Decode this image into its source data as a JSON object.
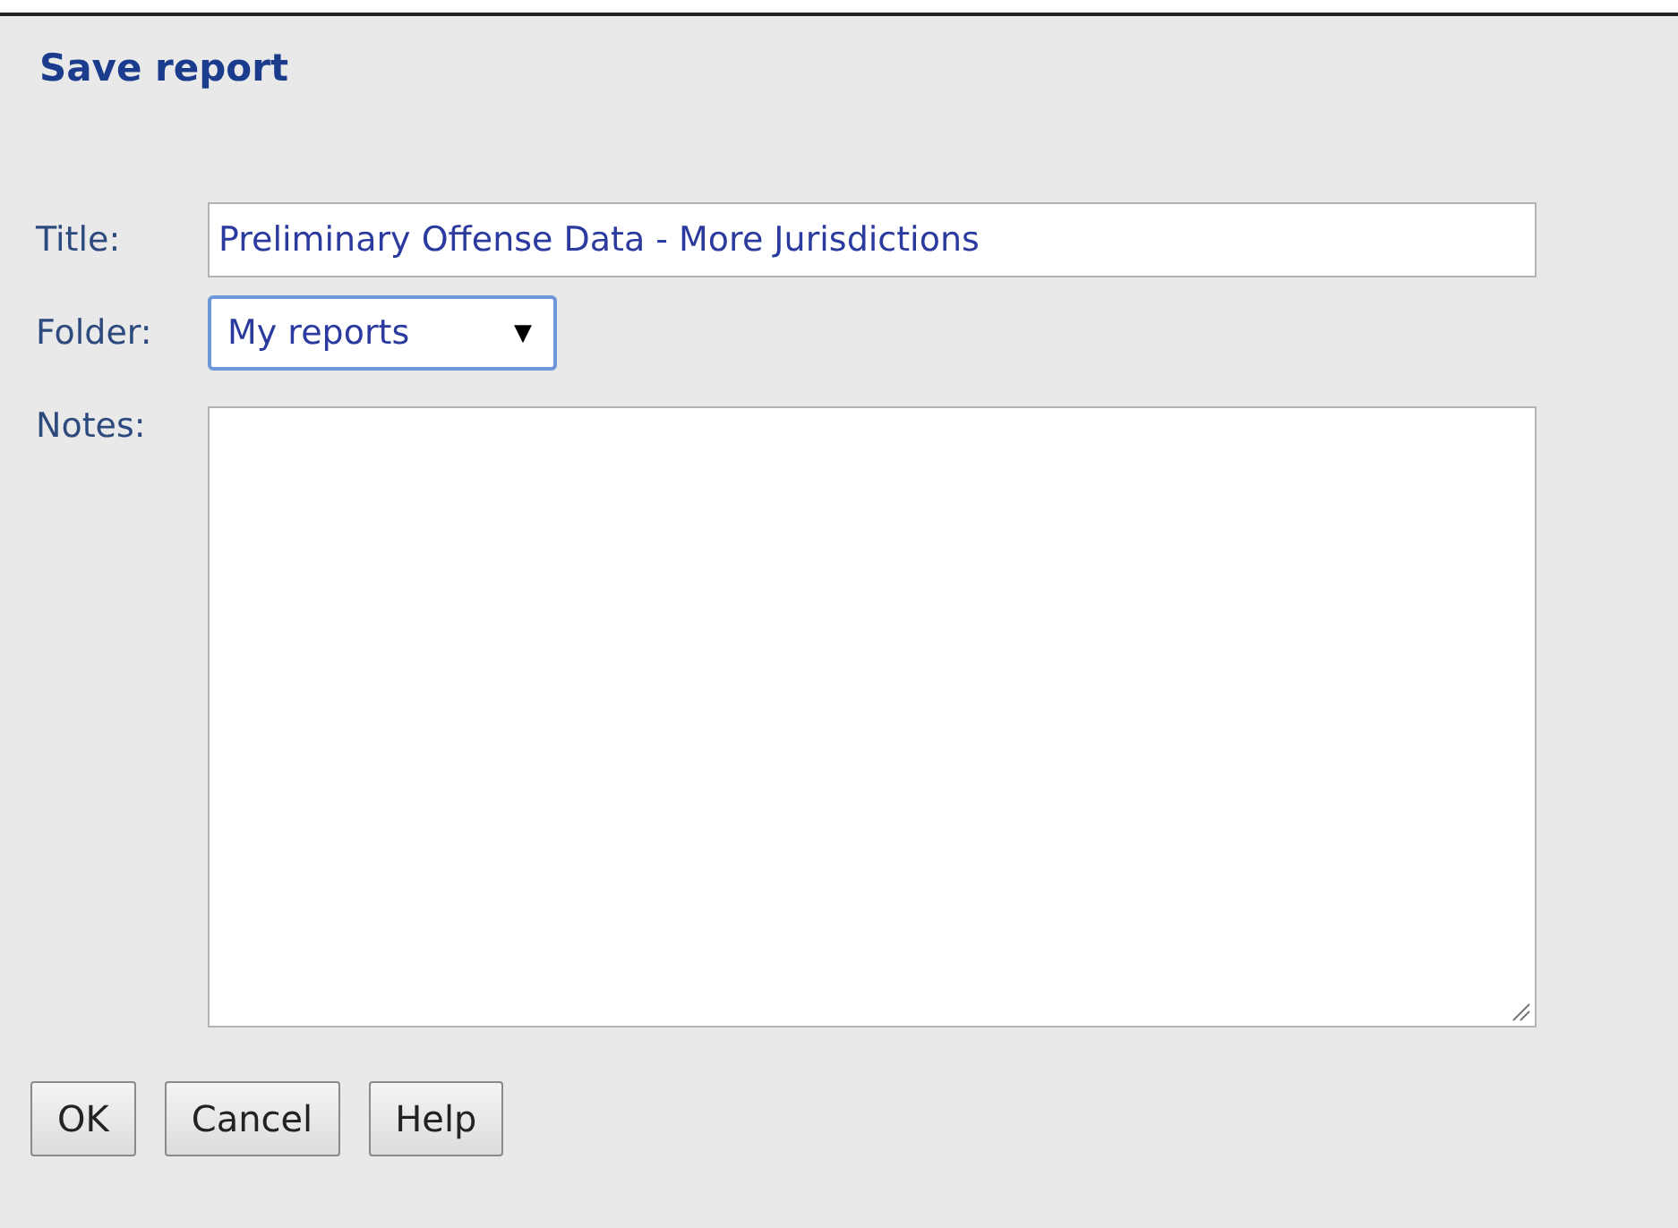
{
  "dialog": {
    "title": "Save report"
  },
  "fields": [
    {
      "kind": "text",
      "label": "Title:",
      "value": "Preliminary Offense Data - More Jurisdictions"
    },
    {
      "kind": "select",
      "label": "Folder:",
      "value": "My reports",
      "arrow": "▼"
    },
    {
      "kind": "textarea",
      "label": "Notes:"
    }
  ],
  "buttons": [
    "OK",
    "Cancel",
    "Help"
  ]
}
